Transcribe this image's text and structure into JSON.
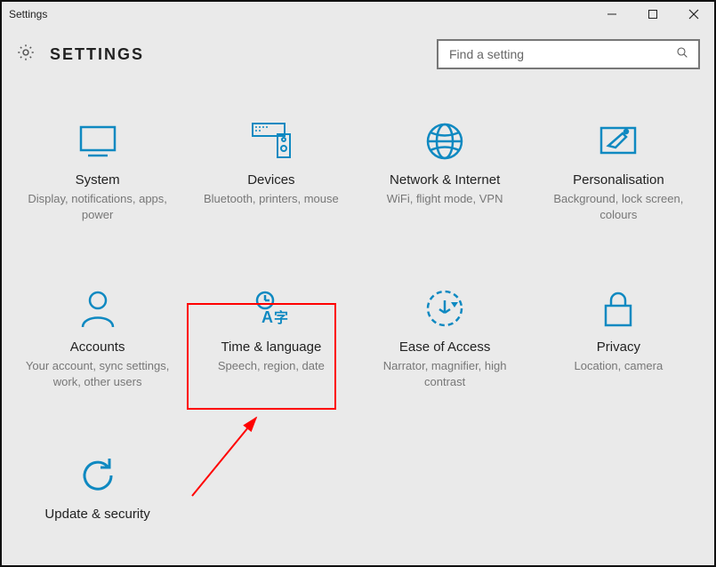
{
  "titlebar": {
    "title": "Settings"
  },
  "header": {
    "title": "SETTINGS"
  },
  "search": {
    "placeholder": "Find a setting"
  },
  "tiles": {
    "system": {
      "title": "System",
      "desc": "Display, notifications, apps, power"
    },
    "devices": {
      "title": "Devices",
      "desc": "Bluetooth, printers, mouse"
    },
    "network": {
      "title": "Network & Internet",
      "desc": "WiFi, flight mode, VPN"
    },
    "personal": {
      "title": "Personalisation",
      "desc": "Background, lock screen, colours"
    },
    "accounts": {
      "title": "Accounts",
      "desc": "Your account, sync settings, work, other users"
    },
    "timelang": {
      "title": "Time & language",
      "desc": "Speech, region, date"
    },
    "ease": {
      "title": "Ease of Access",
      "desc": "Narrator, magnifier, high contrast"
    },
    "privacy": {
      "title": "Privacy",
      "desc": "Location, camera"
    },
    "update": {
      "title": "Update & security",
      "desc": ""
    }
  },
  "colors": {
    "accent": "#0f89c1",
    "annotation": "#ff0000"
  }
}
